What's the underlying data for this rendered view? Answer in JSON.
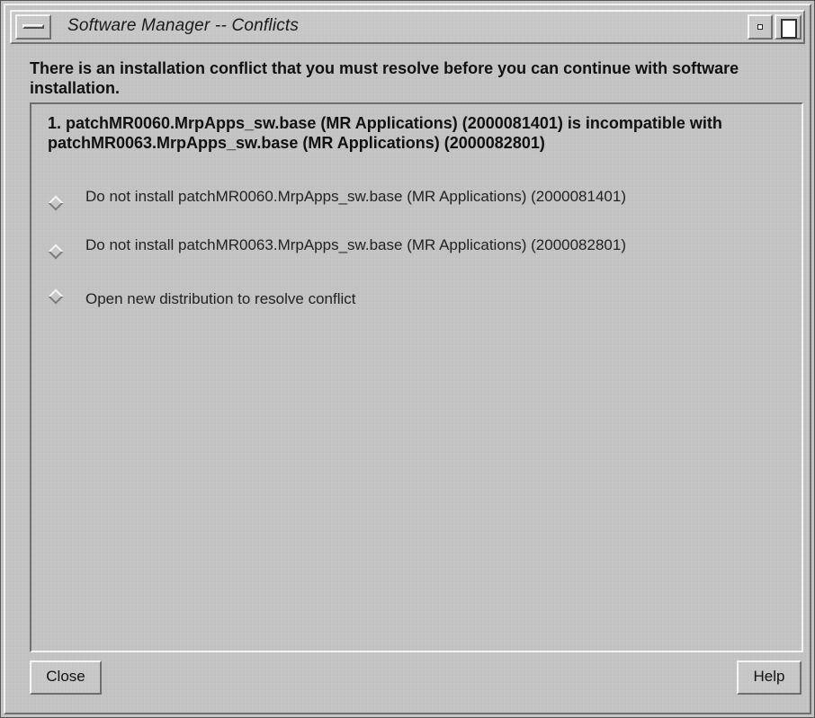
{
  "window": {
    "title": "Software Manager -- Conflicts"
  },
  "header": {
    "message": "There is an installation conflict that you must resolve before you can continue with software installation."
  },
  "conflict": {
    "title": "1. patchMR0060.MrpApps_sw.base (MR Applications) (2000081401) is incompatible with patchMR0063.MrpApps_sw.base (MR Applications) (2000082801)",
    "options": [
      {
        "label": "Do not install patchMR0060.MrpApps_sw.base (MR Applications) (2000081401)",
        "selected": false
      },
      {
        "label": "Do not install patchMR0063.MrpApps_sw.base (MR Applications) (2000082801)",
        "selected": false
      },
      {
        "label": "Open new distribution to resolve conflict",
        "selected": false
      }
    ]
  },
  "buttons": {
    "close_label": "Close",
    "help_label": "Help"
  },
  "colors": {
    "background": "#c4c4c4",
    "text": "#111111"
  }
}
